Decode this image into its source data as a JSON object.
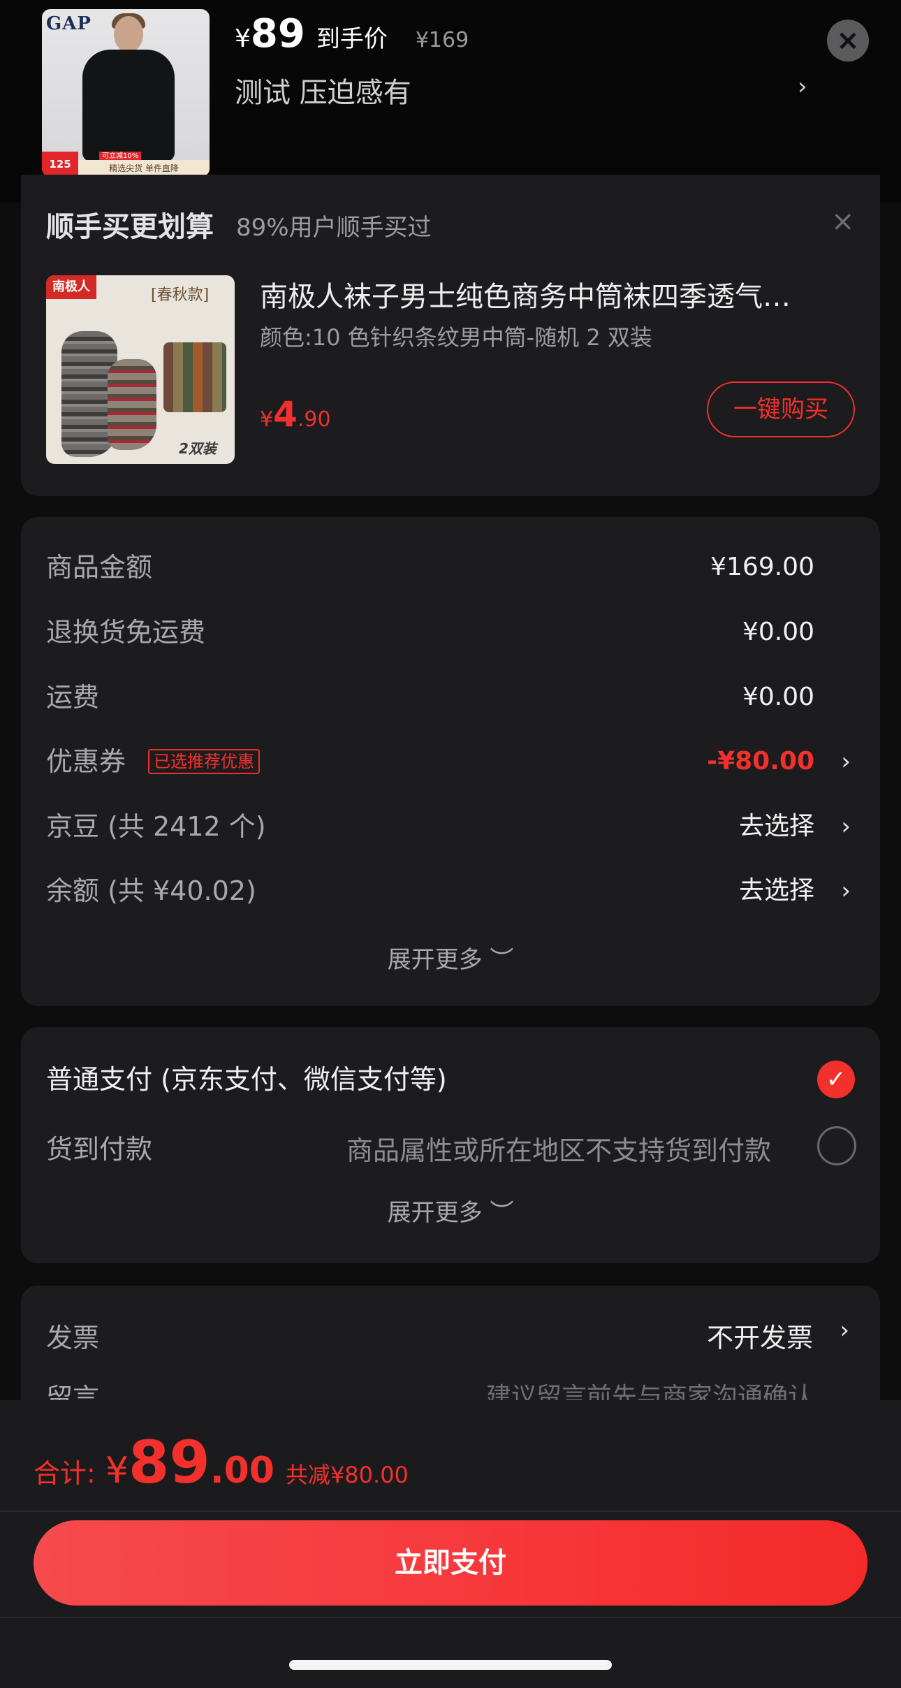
{
  "header": {
    "thumb_brand": "GAP",
    "thumb_badge_price": "125",
    "thumb_badge_tag": "可立减10%",
    "thumb_badge_strip": "精选尖货 单件直降",
    "price_currency": "¥",
    "price_value": "89",
    "price_label": "到手价",
    "original_price": "¥169",
    "spec": "测试   压迫感有",
    "chevron": "›",
    "close_icon": "×"
  },
  "bundle": {
    "title": "顺手买更划算",
    "subtitle": "89%用户顺手买过",
    "close_icon": "×",
    "thumb_brand": "南极人",
    "thumb_season": "[春秋款]",
    "thumb_pack": "2双装",
    "product_name": "南极人袜子男士纯色商务中筒袜四季透气…",
    "variant": "颜色:10 色针织条纹男中筒-随机 2 双装",
    "price_currency": "¥",
    "price_int": "4",
    "price_dec": ".90",
    "buy_label": "一键购买"
  },
  "amounts": {
    "rows": [
      {
        "label": "商品金额",
        "value": "¥169.00",
        "chevron": ""
      },
      {
        "label": "退换货免运费",
        "value": "¥0.00",
        "chevron": ""
      },
      {
        "label": "运费",
        "value": "¥0.00",
        "chevron": ""
      },
      {
        "label": "优惠券",
        "value": "-¥80.00",
        "chevron": "›",
        "tag": "已选推荐优惠"
      },
      {
        "label": "京豆 (共 2412 个)",
        "value": "去选择",
        "chevron": "›"
      },
      {
        "label": "余额 (共 ¥40.02)",
        "value": "去选择",
        "chevron": "›"
      }
    ],
    "expand_label": "展开更多 ︶"
  },
  "payment": {
    "main_option": "普通支付 (京东支付、微信支付等)",
    "check_icon": "✓",
    "cod_label": "货到付款",
    "cod_note": "商品属性或所在地区不支持货到付款",
    "expand_label": "展开更多 ︶"
  },
  "invoice": {
    "label": "发票",
    "value": "不开发票",
    "chevron": "›",
    "remark_label": "留言",
    "remark_placeholder": "建议留言前先与商家沟通确认"
  },
  "footer": {
    "total_label": "合计:",
    "total_currency": "¥",
    "total_int": "89",
    "total_dec": ".00",
    "total_saved": "共减¥80.00",
    "pay_button": "立即支付"
  },
  "colors": {
    "accent": "#f2302c",
    "background": "#0d0d0e",
    "card": "#1c1c1e"
  }
}
